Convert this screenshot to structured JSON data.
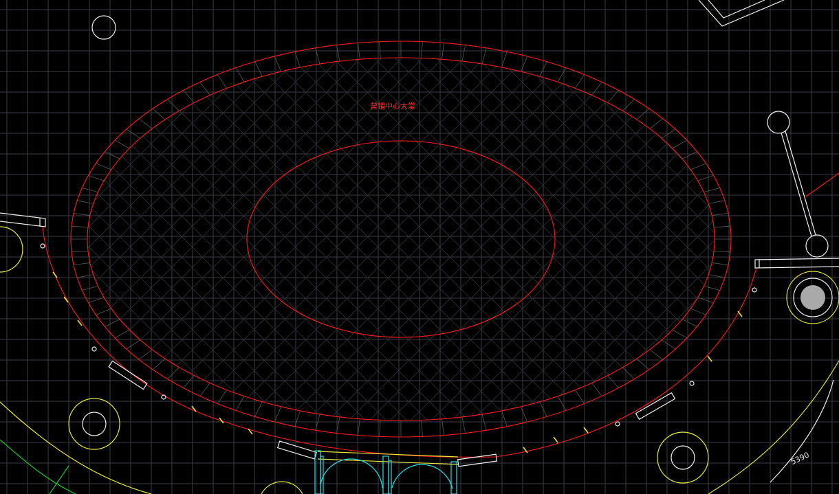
{
  "drawing": {
    "hall_label": "营销中心大堂",
    "dimension_label": "5390"
  },
  "colors": {
    "background": "#000000",
    "grid": "#3a3e47",
    "wall_red": "#ff1a1a",
    "white_lines": "#f2f2f2",
    "yellow_lines": "#e8e83a",
    "green_lines": "#22c832",
    "cyan_lines": "#27e0e8"
  }
}
